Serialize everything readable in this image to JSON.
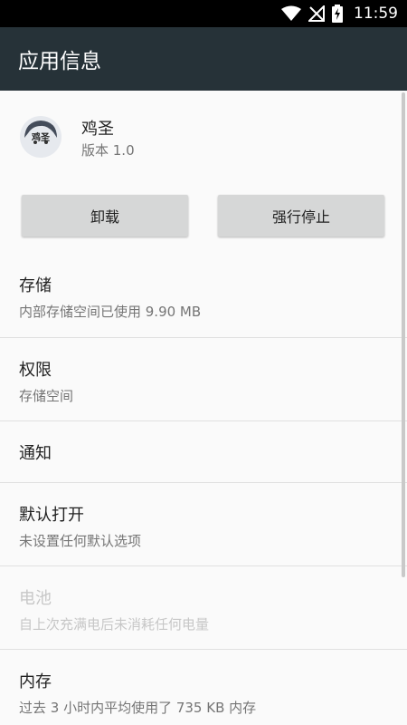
{
  "status_bar": {
    "time": "11:59",
    "icons": [
      "wifi-icon",
      "no-signal-icon",
      "battery-charging-icon"
    ]
  },
  "app_bar": {
    "title": "应用信息"
  },
  "app": {
    "icon_label": "鸡圣",
    "name": "鸡圣",
    "version": "版本 1.0"
  },
  "buttons": {
    "uninstall": "卸载",
    "force_stop": "强行停止"
  },
  "sections": [
    {
      "title": "存储",
      "subtitle": "内部存储空间已使用 9.90 MB",
      "enabled": true
    },
    {
      "title": "权限",
      "subtitle": "存储空间",
      "enabled": true
    },
    {
      "title": "通知",
      "subtitle": "",
      "enabled": true
    },
    {
      "title": "默认打开",
      "subtitle": "未设置任何默认选项",
      "enabled": true
    },
    {
      "title": "电池",
      "subtitle": "自上次充满电后未消耗任何电量",
      "enabled": false
    },
    {
      "title": "内存",
      "subtitle": "过去 3 小时内平均使用了 735 KB 内存",
      "enabled": true
    }
  ]
}
